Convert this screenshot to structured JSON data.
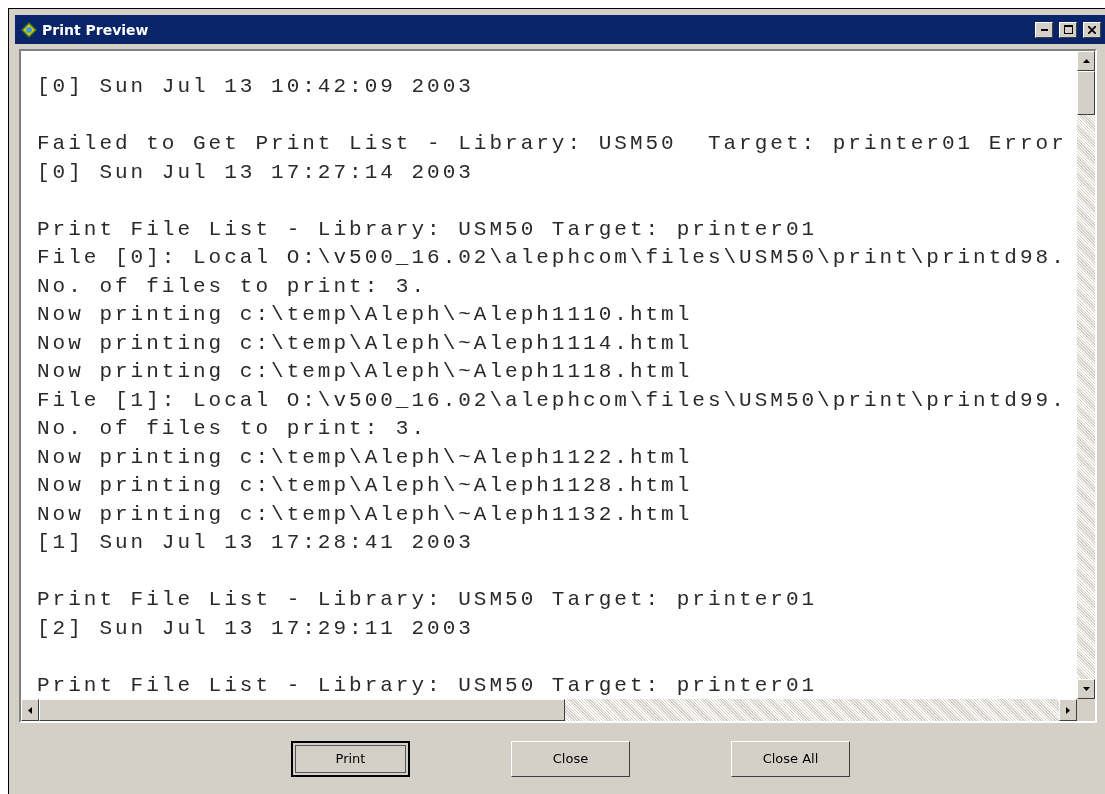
{
  "window": {
    "title": "Print Preview"
  },
  "log_blocks": [
    {
      "lines": [
        "[0] Sun Jul 13 10:42:09 2003"
      ]
    },
    {
      "lines": [
        "Failed to Get Print List - Library: USM50  Target: printer01 Error",
        "[0] Sun Jul 13 17:27:14 2003"
      ]
    },
    {
      "lines": [
        "Print File List - Library: USM50 Target: printer01",
        "File [0]: Local O:\\v500_16.02\\alephcom\\files\\USM50\\print\\printd98.",
        "No. of files to print: 3.",
        "Now printing c:\\temp\\Aleph\\~Aleph1110.html",
        "Now printing c:\\temp\\Aleph\\~Aleph1114.html",
        "Now printing c:\\temp\\Aleph\\~Aleph1118.html",
        "File [1]: Local O:\\v500_16.02\\alephcom\\files\\USM50\\print\\printd99.",
        "No. of files to print: 3.",
        "Now printing c:\\temp\\Aleph\\~Aleph1122.html",
        "Now printing c:\\temp\\Aleph\\~Aleph1128.html",
        "Now printing c:\\temp\\Aleph\\~Aleph1132.html",
        "[1] Sun Jul 13 17:28:41 2003"
      ]
    },
    {
      "lines": [
        "Print File List - Library: USM50 Target: printer01",
        "[2] Sun Jul 13 17:29:11 2003"
      ]
    },
    {
      "lines": [
        "Print File List - Library: USM50 Target: printer01"
      ]
    }
  ],
  "buttons": [
    {
      "label": "Print",
      "default": true
    },
    {
      "label": "Close",
      "default": false
    },
    {
      "label": "Close All",
      "default": false
    }
  ]
}
